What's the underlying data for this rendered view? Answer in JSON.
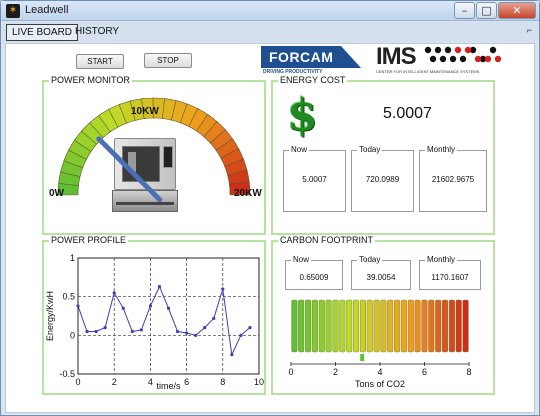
{
  "window": {
    "title": "Leadwell",
    "icon": "app-icon"
  },
  "tabs": [
    {
      "label": "LIVE BOARD"
    },
    {
      "label": "HISTORY"
    }
  ],
  "controls": {
    "start": "START",
    "stop": "STOP"
  },
  "logos": {
    "forcam": {
      "name": "FORCAM",
      "tagline": "DRIVING PRODUCTIVITY"
    },
    "ims": {
      "name": "IMS",
      "tagline": "CENTER FOR INTELLIGENT MAINTENANCE SYSTEMS"
    }
  },
  "power_monitor": {
    "title": "POWER MONITOR",
    "label_min": "0W",
    "label_mid": "10KW",
    "label_max": "20KW",
    "min_value": 0,
    "max_value": 20,
    "needle_value": 5.0,
    "image": "cnc-machine-icon"
  },
  "energy_cost": {
    "title": "ENERGY COST",
    "total": "5.0007",
    "icon": "dollar-icon",
    "boxes": [
      {
        "label": "Now",
        "value": "5.0007"
      },
      {
        "label": "Today",
        "value": "720.0989"
      },
      {
        "label": "Monthly",
        "value": "21602.9675"
      }
    ]
  },
  "power_profile": {
    "title": "POWER PROFILE",
    "chart_data": {
      "type": "line",
      "xlabel": "time/s",
      "ylabel": "Energy/KwH",
      "xlim": [
        0,
        10
      ],
      "ylim": [
        -0.5,
        1
      ],
      "xticks": [
        "0",
        "2",
        "4",
        "6",
        "8",
        "10"
      ],
      "yticks": [
        "-0.5",
        "0",
        "0.5",
        "1"
      ],
      "grid": true,
      "color": "#3f3fb8",
      "x": [
        0,
        0.5,
        1,
        1.5,
        2,
        2.5,
        3,
        3.5,
        4,
        4.5,
        5,
        5.5,
        6,
        6.5,
        7,
        7.5,
        8,
        8.5,
        9,
        9.5
      ],
      "y": [
        0.38,
        0.05,
        0.05,
        0.1,
        0.55,
        0.35,
        0.05,
        0.07,
        0.38,
        0.63,
        0.35,
        0.05,
        0.03,
        0.0,
        0.1,
        0.22,
        0.6,
        -0.25,
        0.0,
        0.1
      ]
    }
  },
  "carbon_footprint": {
    "title": "CARBON FOOTPRINT",
    "boxes": [
      {
        "label": "Now",
        "value": "0.65009"
      },
      {
        "label": "Today",
        "value": "39.0054"
      },
      {
        "label": "Monthly",
        "value": "1170.1607"
      }
    ],
    "gauge": {
      "xlabel": "Tons of CO2",
      "xlim": [
        0,
        8
      ],
      "ticks": [
        "0",
        "2",
        "4",
        "6",
        "8"
      ],
      "marker_value": 3.2
    }
  },
  "colors": {
    "panel_border": "#b7e3a0",
    "dollar": "#1f8a1f",
    "chart_line": "#3f3fb8",
    "window_bg": "#d7e4f2"
  }
}
